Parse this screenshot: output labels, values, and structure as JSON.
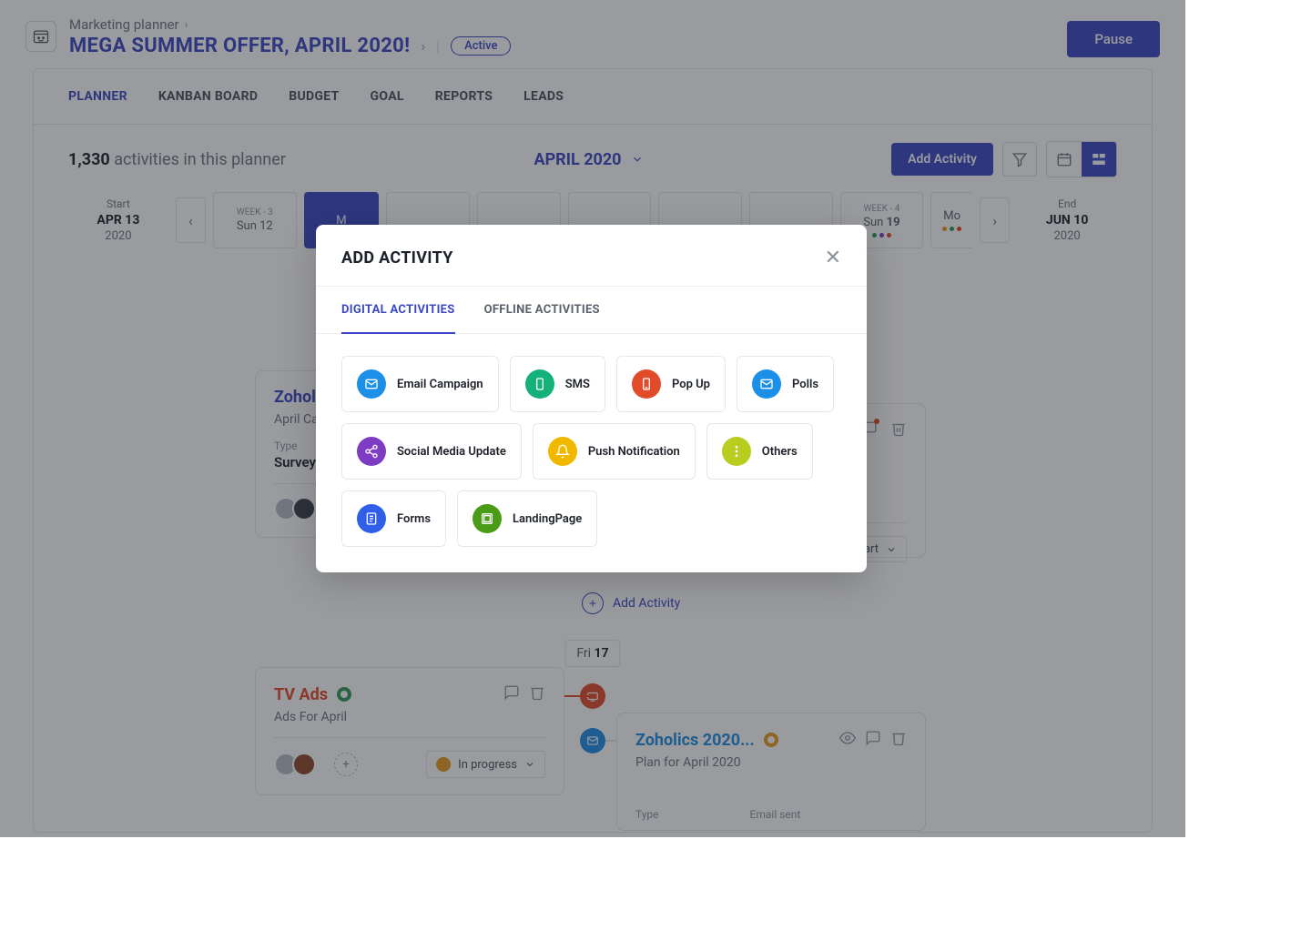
{
  "breadcrumb": {
    "parent": "Marketing planner"
  },
  "page": {
    "title": "MEGA SUMMER OFFER, APRIL 2020!",
    "status": "Active",
    "pause": "Pause"
  },
  "tabs": [
    "PLANNER",
    "KANBAN BOARD",
    "BUDGET",
    "GOAL",
    "REPORTS",
    "LEADS"
  ],
  "summary": {
    "count": "1,330",
    "suffix": "activities in this planner",
    "month": "APRIL 2020",
    "addActivity": "Add Activity"
  },
  "dateScroll": {
    "start": {
      "label": "Start",
      "date": "APR 13",
      "year": "2020"
    },
    "end": {
      "label": "End",
      "date": "JUN 10",
      "year": "2020"
    },
    "cells": [
      {
        "week": "WEEK - 3",
        "day": "Sun 12"
      },
      {
        "day": "Mon",
        "active": true
      },
      {
        "day": ""
      },
      {
        "day": ""
      },
      {
        "day": ""
      },
      {
        "day": ""
      },
      {
        "day": ""
      },
      {
        "week": "WEEK - 4",
        "day": "Sun",
        "dayNum": "19",
        "dots": [
          "#2e9b5b",
          "#7d3cc2",
          "#e04b2a"
        ]
      },
      {
        "day": "Mo",
        "dots": [
          "#e79b1f",
          "#2e9b5b",
          "#e04b2a"
        ]
      }
    ]
  },
  "timeline": {
    "addInline": "Add Activity",
    "dateChip": {
      "pre": "Fri ",
      "bold": "17"
    },
    "cards": {
      "zoholics": {
        "title": "Zoholi",
        "titleColor": "#3b48c5",
        "sub": "April Ca",
        "metaLabel": "Type",
        "metaValue": "Survey A"
      },
      "tv": {
        "title": "TV Ads",
        "titleColor": "#e04b2a",
        "sub": "Ads For April",
        "progress": "In progress"
      },
      "rightPartial": {
        "progress": "start"
      },
      "zoholics2": {
        "title": "Zoholics 2020...",
        "titleColor": "#1c8fe8",
        "sub": "Plan for April 2020",
        "metaLabel": "Type",
        "metaLabel2": "Email sent"
      }
    }
  },
  "modal": {
    "title": "ADD ACTIVITY",
    "tabs": [
      "DIGITAL ACTIVITIES",
      "OFFLINE ACTIVITIES"
    ],
    "activities": [
      {
        "label": "Email Campaign",
        "color": "#1c8fe8",
        "icon": "mail"
      },
      {
        "label": "SMS",
        "color": "#15b17a",
        "icon": "phone"
      },
      {
        "label": "Pop Up",
        "color": "#e04b2a",
        "icon": "device"
      },
      {
        "label": "Polls",
        "color": "#1c8fe8",
        "icon": "mail"
      },
      {
        "label": "Social Media Update",
        "color": "#7d3cc2",
        "icon": "share"
      },
      {
        "label": "Push Notification",
        "color": "#f0b900",
        "icon": "bell"
      },
      {
        "label": "Others",
        "color": "#b8cd20",
        "icon": "dots"
      },
      {
        "label": "Forms",
        "color": "#2f5ee8",
        "icon": "form"
      },
      {
        "label": "LandingPage",
        "color": "#4a9b15",
        "icon": "page"
      }
    ]
  }
}
